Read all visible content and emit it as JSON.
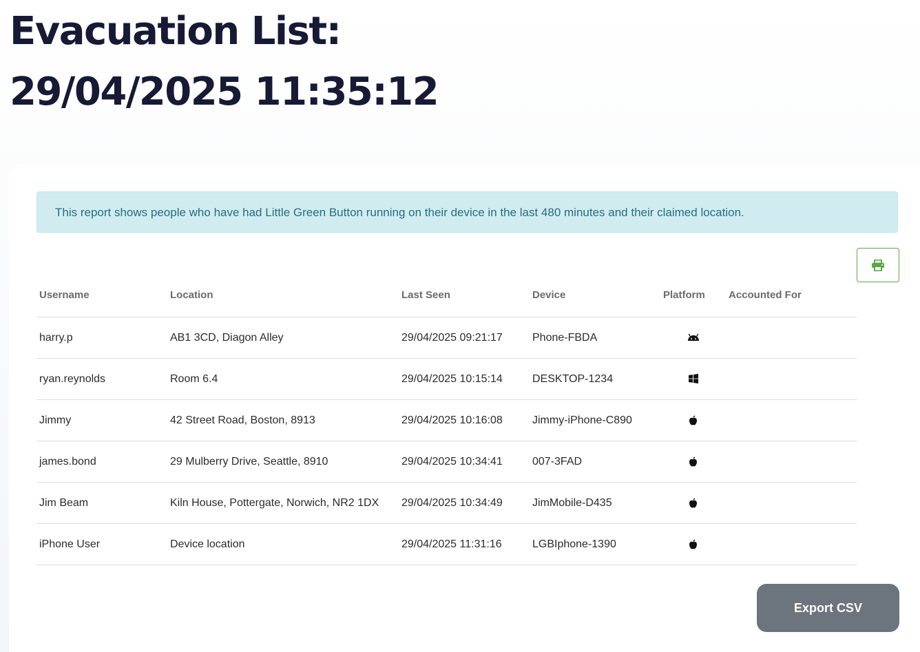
{
  "header": {
    "title_line1": "Evacuation List:",
    "title_line2": "29/04/2025 11:35:12"
  },
  "alert": {
    "text": "This report shows people who have had Little Green Button running on their device in the last 480 minutes and their claimed location."
  },
  "print_button": {
    "icon": "printer-icon",
    "color": "#5aa745"
  },
  "table": {
    "columns": [
      "Username",
      "Location",
      "Last Seen",
      "Device",
      "Platform",
      "Accounted For"
    ],
    "rows": [
      {
        "username": "harry.p",
        "location": "AB1 3CD, Diagon Alley",
        "last_seen": "29/04/2025 09:21:17",
        "device": "Phone-FBDA",
        "platform_icon": "android-icon",
        "accounted_for": ""
      },
      {
        "username": "ryan.reynolds",
        "location": "Room 6.4",
        "last_seen": "29/04/2025 10:15:14",
        "device": "DESKTOP-1234",
        "platform_icon": "windows-icon",
        "accounted_for": ""
      },
      {
        "username": "Jimmy",
        "location": "42 Street Road, Boston, 8913",
        "last_seen": "29/04/2025 10:16:08",
        "device": "Jimmy-iPhone-C890",
        "platform_icon": "apple-icon",
        "accounted_for": ""
      },
      {
        "username": "james.bond",
        "location": "29 Mulberry Drive, Seattle, 8910",
        "last_seen": "29/04/2025 10:34:41",
        "device": "007-3FAD",
        "platform_icon": "apple-icon",
        "accounted_for": ""
      },
      {
        "username": "Jim Beam",
        "location": "Kiln House, Pottergate, Norwich, NR2 1DX",
        "last_seen": "29/04/2025 10:34:49",
        "device": "JimMobile-D435",
        "platform_icon": "apple-icon",
        "accounted_for": ""
      },
      {
        "username": "iPhone User",
        "location": "Device location",
        "last_seen": "29/04/2025 11:31:16",
        "device": "LGBIphone-1390",
        "platform_icon": "apple-icon",
        "accounted_for": ""
      }
    ]
  },
  "export_button": {
    "label": "Export CSV",
    "color": "#6c757d"
  }
}
